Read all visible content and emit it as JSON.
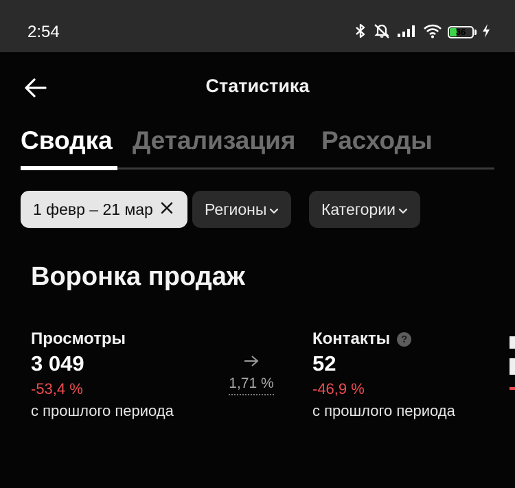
{
  "status_bar": {
    "time": "2:54",
    "battery": "36",
    "battery_level_percent": 36,
    "icons": [
      "bluetooth-icon",
      "mute-icon",
      "signal-icon",
      "wifi-icon",
      "battery-icon",
      "charging-icon"
    ]
  },
  "header": {
    "back_icon": "arrow-left-icon",
    "title": "Статистика"
  },
  "tabs": [
    {
      "label": "Сводка",
      "active": true
    },
    {
      "label": "Детализация",
      "active": false
    },
    {
      "label": "Расходы",
      "active": false
    }
  ],
  "filters": {
    "date_range": "1 февр – 21 мар",
    "regions": "Регионы",
    "categories": "Категории"
  },
  "funnel": {
    "title": "Воронка продаж",
    "views": {
      "label": "Просмотры",
      "value": "3 049",
      "change": "-53,4 %",
      "period": "с прошлого периода"
    },
    "conversion": "1,71 %",
    "contacts": {
      "label": "Контакты",
      "value": "52",
      "change": "-46,9 %",
      "period": "с прошлого периода"
    }
  },
  "colors": {
    "background": "#050505",
    "status_bar": "#2b2b2b",
    "negative": "#ef4d52",
    "inactive_tab": "#6d6d6d",
    "chip_active": "#e6e6e6",
    "chip_dark": "#2a2a2a",
    "battery_fill": "#3fd34a"
  }
}
